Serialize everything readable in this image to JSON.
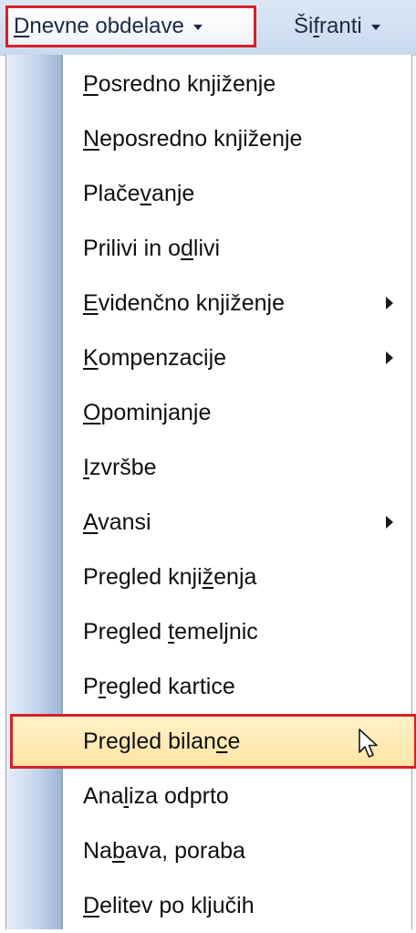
{
  "menubar": {
    "items": [
      {
        "pre": "",
        "u": "D",
        "post": "nevne obdelave"
      },
      {
        "pre": "Ši",
        "u": "f",
        "post": "ranti"
      }
    ]
  },
  "dropdown": {
    "items": [
      {
        "pre": "",
        "u": "P",
        "post": "osredno knjiženje",
        "submenu": false
      },
      {
        "pre": "",
        "u": "N",
        "post": "eposredno knjiženje",
        "submenu": false
      },
      {
        "pre": "Plače",
        "u": "v",
        "post": "anje",
        "submenu": false
      },
      {
        "pre": "Prilivi in o",
        "u": "d",
        "post": "livi",
        "submenu": false
      },
      {
        "pre": "",
        "u": "E",
        "post": "videnčno knjiženje",
        "submenu": true
      },
      {
        "pre": "",
        "u": "K",
        "post": "ompenzacije",
        "submenu": true
      },
      {
        "pre": "",
        "u": "O",
        "post": "pominjanje",
        "submenu": false
      },
      {
        "pre": "",
        "u": "I",
        "post": "zvršbe",
        "submenu": false
      },
      {
        "pre": "",
        "u": "A",
        "post": "vansi",
        "submenu": true
      },
      {
        "pre": "Pregled knji",
        "u": "ž",
        "post": "enja",
        "submenu": false
      },
      {
        "pre": "Pregled ",
        "u": "t",
        "post": "emeljnic",
        "submenu": false
      },
      {
        "pre": "P",
        "u": "r",
        "post": "egled kartice",
        "submenu": false
      },
      {
        "pre": "Pregled bilan",
        "u": "c",
        "post": "e",
        "submenu": false
      },
      {
        "pre": "Ana",
        "u": "l",
        "post": "iza odprto",
        "submenu": false
      },
      {
        "pre": "Na",
        "u": "b",
        "post": "ava, poraba",
        "submenu": false
      },
      {
        "pre": "",
        "u": "D",
        "post": "elitev po ključih",
        "submenu": false
      }
    ],
    "highlighted_index": 12
  },
  "icons": {
    "submenu_arrow": "chevron-right-icon",
    "dropdown_arrow": "chevron-down-icon",
    "cursor": "mouse-pointer-icon"
  },
  "colors": {
    "highlight_outline": "#d8202a",
    "highlight_fill": "#fde4a3",
    "gutter": "#c6d6ec"
  }
}
